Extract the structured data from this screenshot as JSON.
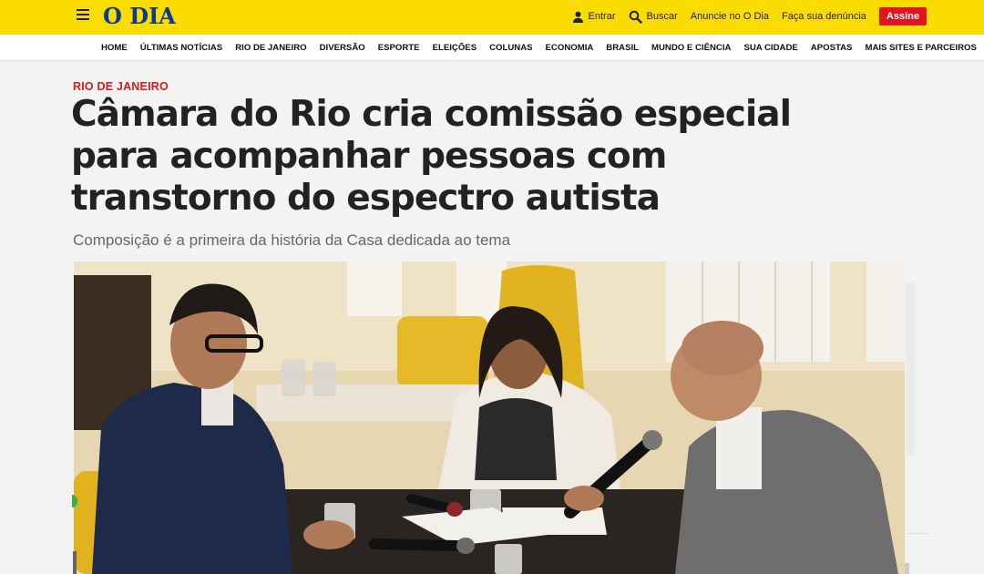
{
  "header": {
    "logo_text": "O DIA",
    "actions": {
      "login": "Entrar",
      "search": "Buscar",
      "advertise": "Anuncie no O Dia",
      "report": "Faça sua denúncia",
      "subscribe": "Assine"
    }
  },
  "nav": {
    "items": [
      "HOME",
      "ÚLTIMAS NOTÍCIAS",
      "RIO DE JANEIRO",
      "DIVERSÃO",
      "ESPORTE",
      "ELEIÇÕES",
      "COLUNAS",
      "ECONOMIA",
      "BRASIL",
      "MUNDO E CIÊNCIA",
      "SUA CIDADE",
      "APOSTAS",
      "MAIS SITES E PARCEIROS"
    ]
  },
  "article": {
    "section": "RIO DE JANEIRO",
    "headline_lines": [
      "Câmara do Rio cria comissão especial",
      "para acompanhar pessoas com",
      "transtorno do espectro autista"
    ],
    "subtitle": "Composição é a primeira da história da Casa dedicada ao tema"
  },
  "colors": {
    "brand_yellow": "#fbdc00",
    "logo_blue": "#0a3b8f",
    "accent_red": "#e1141d",
    "kicker_red": "#d61c1c"
  }
}
